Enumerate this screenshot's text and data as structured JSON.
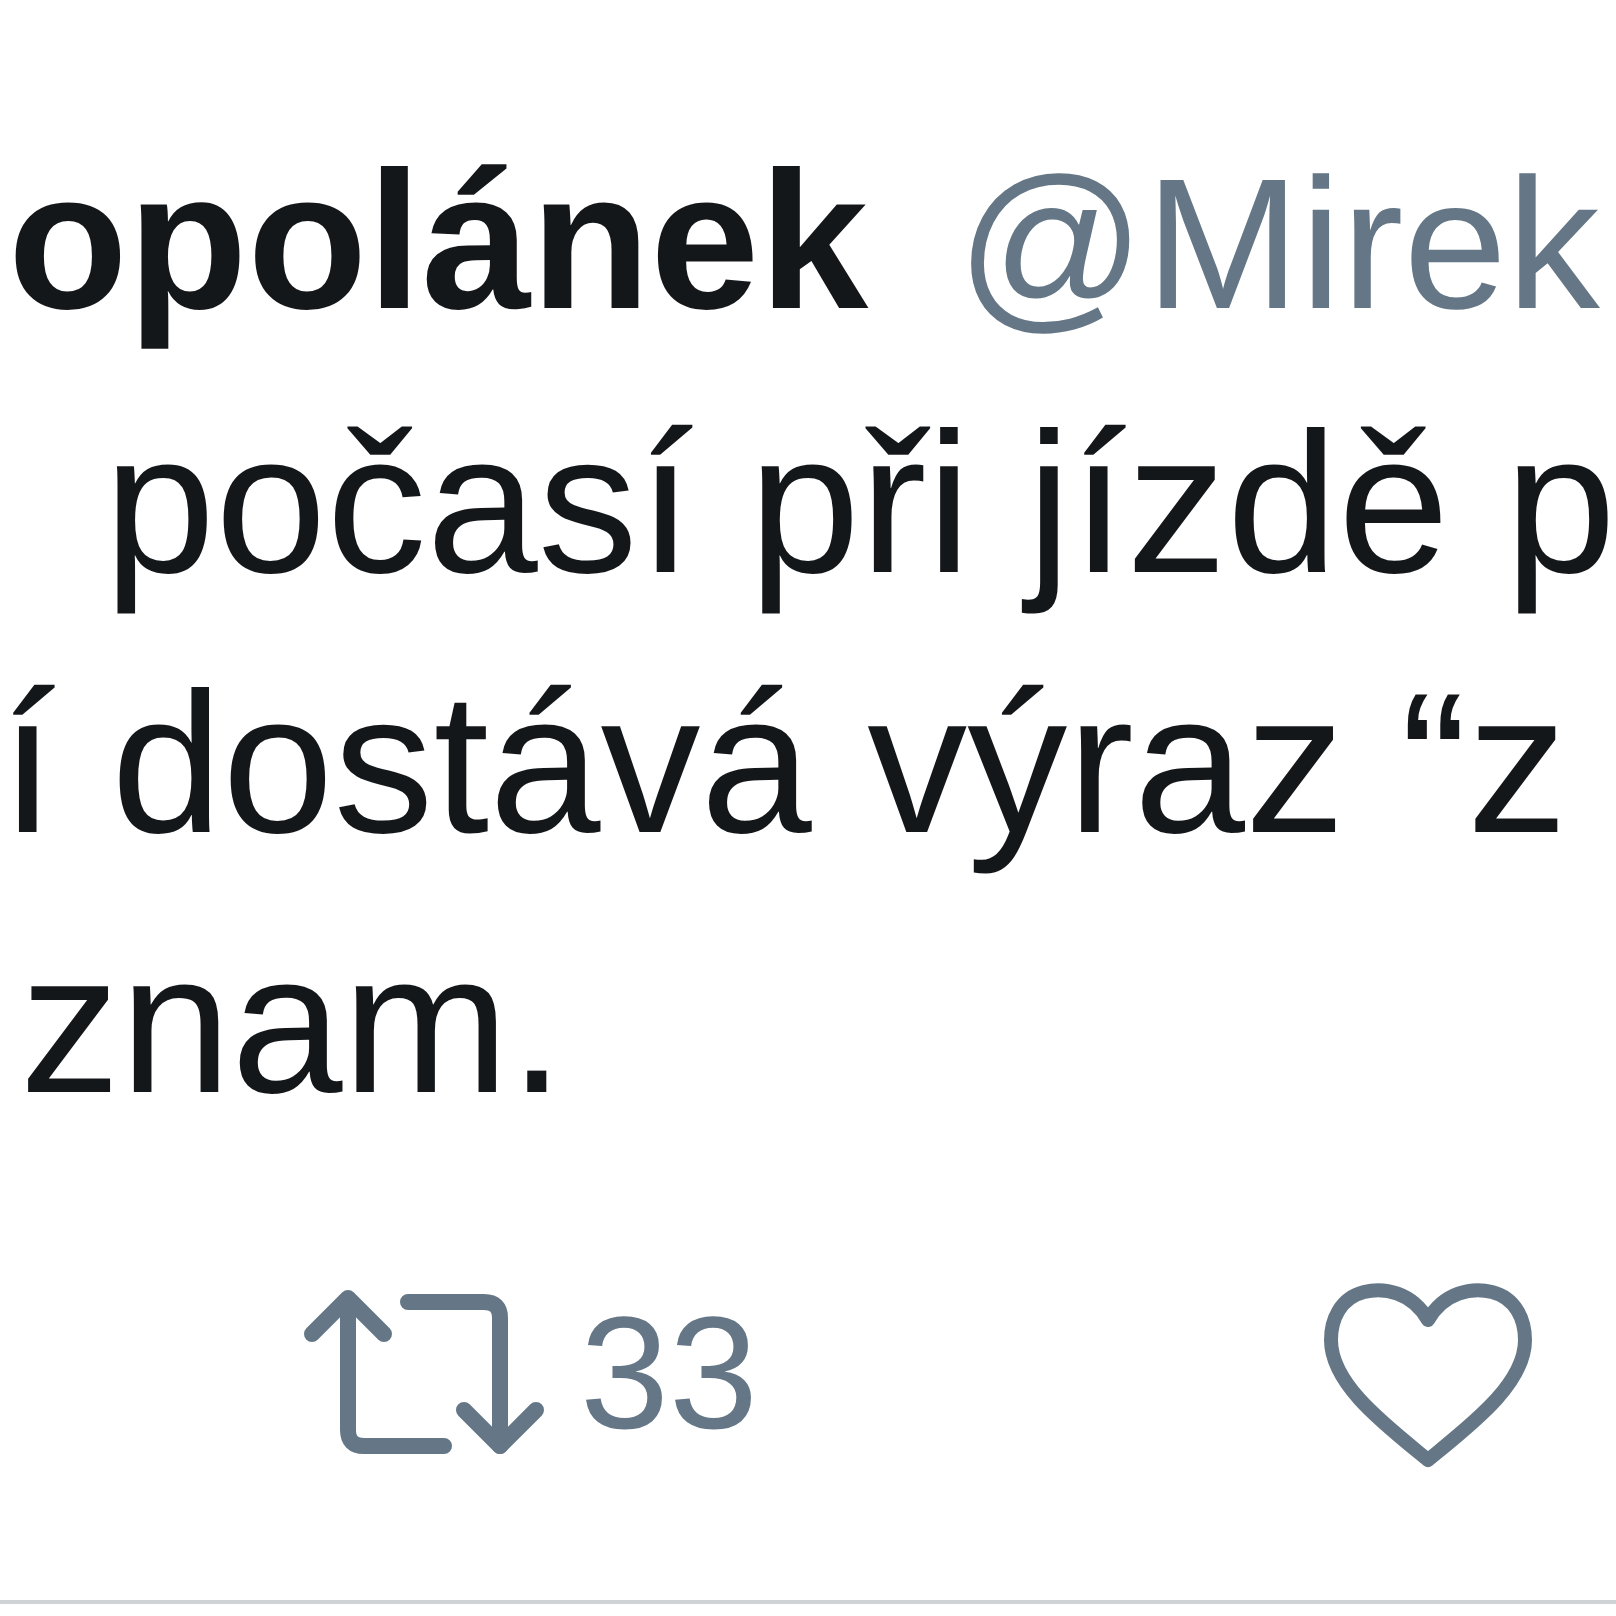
{
  "author": {
    "name": "opolánek",
    "handle": "@Mirek"
  },
  "text_lines": [
    "počasí při jízdě p",
    "í dostává výraz “z",
    "znam."
  ],
  "actions": [
    {
      "kind": "retweet",
      "count": "33"
    },
    {
      "kind": "like"
    }
  ]
}
